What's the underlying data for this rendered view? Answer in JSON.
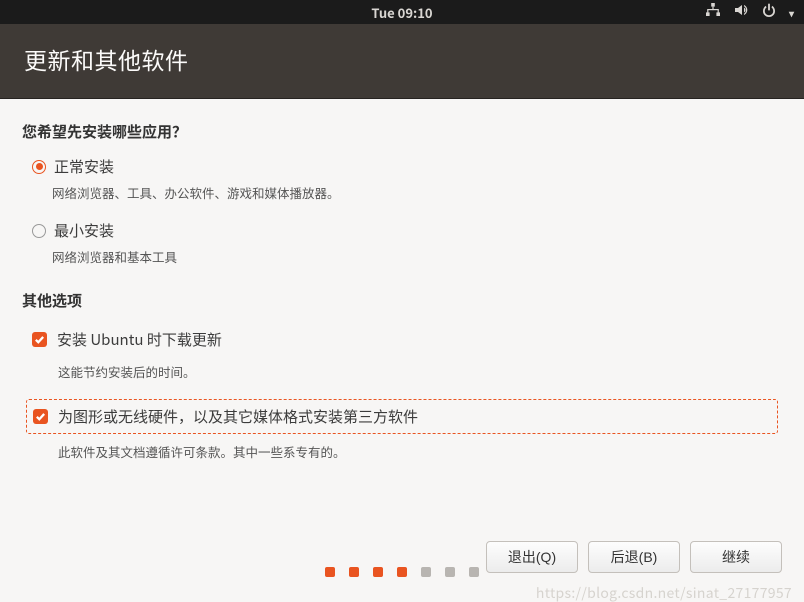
{
  "topbar": {
    "clock": "Tue 09:10"
  },
  "header": {
    "title": "更新和其他软件"
  },
  "main": {
    "question": "您希望先安装哪些应用？",
    "opt1": {
      "label": "正常安装",
      "desc": "网络浏览器、工具、办公软件、游戏和媒体播放器。",
      "selected": true
    },
    "opt2": {
      "label": "最小安装",
      "desc": "网络浏览器和基本工具",
      "selected": false
    },
    "other_title": "其他选项",
    "cb1": {
      "label": "安装 Ubuntu 时下载更新",
      "desc": "这能节约安装后的时间。",
      "checked": true
    },
    "cb2": {
      "label": "为图形或无线硬件，以及其它媒体格式安装第三方软件",
      "desc": "此软件及其文档遵循许可条款。其中一些系专有的。",
      "checked": true,
      "focused": true
    }
  },
  "buttons": {
    "quit": "退出(Q)",
    "back": "后退(B)",
    "continue": "继续"
  },
  "progress": {
    "total": 7,
    "done": 4
  },
  "watermark": "https://blog.csdn.net/sinat_27177957"
}
